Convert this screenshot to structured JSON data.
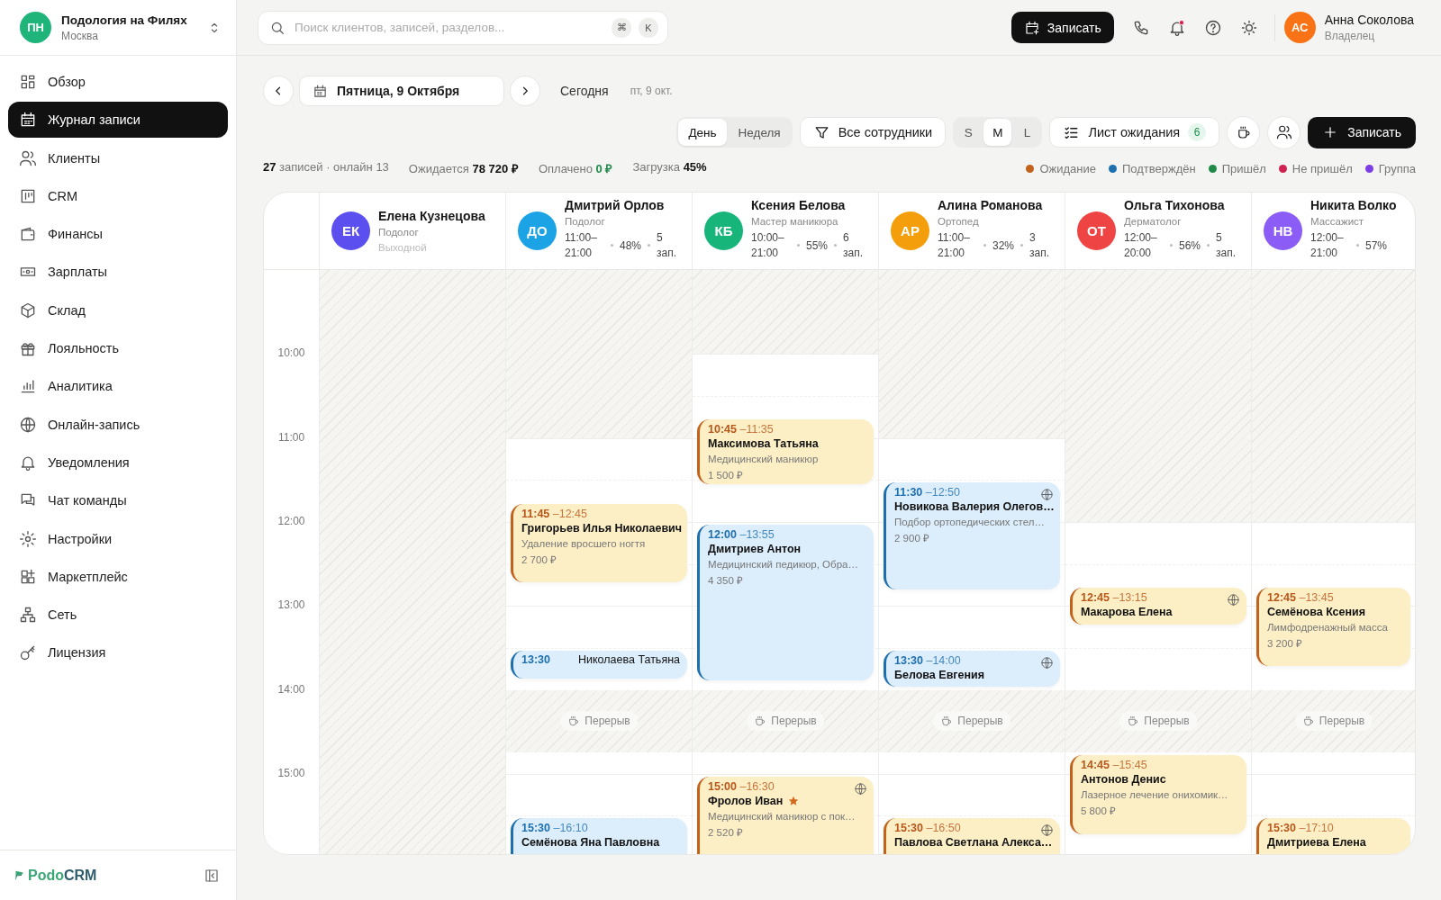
{
  "org": {
    "initials": "ПН",
    "name": "Подология на Филях",
    "city": "Москва"
  },
  "sidebar": {
    "items": [
      {
        "label": "Обзор",
        "selected": false
      },
      {
        "label": "Журнал записи",
        "selected": true
      },
      {
        "label": "Клиенты",
        "selected": false
      },
      {
        "label": "CRM",
        "selected": false
      },
      {
        "label": "Финансы",
        "selected": false
      },
      {
        "label": "Зарплаты",
        "selected": false
      },
      {
        "label": "Склад",
        "selected": false
      },
      {
        "label": "Лояльность",
        "selected": false
      },
      {
        "label": "Аналитика",
        "selected": false
      },
      {
        "label": "Онлайн-запись",
        "selected": false
      },
      {
        "label": "Уведомления",
        "selected": false
      },
      {
        "label": "Чат команды",
        "selected": false
      },
      {
        "label": "Настройки",
        "selected": false
      },
      {
        "label": "Маркетплейс",
        "selected": false
      },
      {
        "label": "Сеть",
        "selected": false
      },
      {
        "label": "Лицензия",
        "selected": false
      }
    ],
    "logo": {
      "part1": "Podo",
      "part2": "CRM"
    }
  },
  "topbar": {
    "search": {
      "placeholder": "Поиск клиентов, записей, разделов...",
      "keys": [
        "⌘",
        "K"
      ]
    },
    "book_button": "Записать",
    "notifications_unread": true,
    "user": {
      "initials": "АС",
      "name": "Анна Соколова",
      "role": "Владелец"
    }
  },
  "toolbar": {
    "date": "Пятница, 9 Октября",
    "today": "Сегодня",
    "today_hint": "пт, 9 окт.",
    "views": [
      {
        "label": "День",
        "selected": true
      },
      {
        "label": "Неделя",
        "selected": false
      }
    ],
    "staff_filter": "Все сотрудники",
    "sizes": [
      {
        "label": "S",
        "selected": false
      },
      {
        "label": "M",
        "selected": true
      },
      {
        "label": "L",
        "selected": false
      }
    ],
    "waiting_list": {
      "label": "Лист ожидания",
      "count": "6"
    },
    "book_button": "Записать"
  },
  "stats": [
    {
      "kind": "count",
      "value": "27",
      "label": "записей · онлайн 13"
    },
    {
      "kind": "amount",
      "label": "Ожидается",
      "value": "78 720 ₽"
    },
    {
      "kind": "paid",
      "label": "Оплачено",
      "value": "0 ₽"
    },
    {
      "kind": "amount",
      "label": "Загрузка",
      "value": "45%"
    }
  ],
  "legend": [
    {
      "label": "Ожидание",
      "color": "#c2621b"
    },
    {
      "label": "Подтверждён",
      "color": "#1d6fae"
    },
    {
      "label": "Пришёл",
      "color": "#1f8a4a"
    },
    {
      "label": "Не пришёл",
      "color": "#d0224f"
    },
    {
      "label": "Группа",
      "color": "#7b3fe4"
    }
  ],
  "time_labels": [
    "10:00",
    "11:00",
    "12:00",
    "13:00",
    "14:00",
    "15:00"
  ],
  "staff": [
    {
      "initials": "ЕК",
      "color": "#5b4ff0",
      "name": "Елена Кузнецова",
      "role": "Подолог",
      "kind": "off",
      "note": "Выходной"
    },
    {
      "initials": "ДО",
      "color": "#1ba3e6",
      "name": "Дмитрий Орлов",
      "role": "Подолог",
      "kind": "working",
      "hours": "11:00–21:00",
      "load": "48%",
      "count": "5 зап.",
      "break_label": "Перерыв",
      "events": [
        {
          "kind": "full",
          "confirmed": false,
          "start": "11:45",
          "end": "–12:45",
          "name": "Григорьев Илья Николаевич",
          "service": "Удаление вросшего ногтя",
          "price": "2 700 ₽",
          "online": false,
          "starred": false
        },
        {
          "kind": "compact",
          "confirmed": true,
          "start": "13:30",
          "name": "Николаева Татьяна",
          "online": false,
          "starred": false
        },
        {
          "kind": "full",
          "confirmed": true,
          "start": "15:30",
          "end": "–16:10",
          "name": "Семёнова Яна Павловна",
          "online": false,
          "starred": false
        }
      ]
    },
    {
      "initials": "КБ",
      "color": "#18b57a",
      "name": "Ксения Белова",
      "role": "Мастер маникюра",
      "kind": "working",
      "hours": "10:00–21:00",
      "load": "55%",
      "count": "6 зап.",
      "break_label": "Перерыв",
      "events": [
        {
          "kind": "full",
          "confirmed": false,
          "start": "10:45",
          "end": "–11:35",
          "name": "Максимова Татьяна",
          "service": "Медицинский маникюр",
          "price": "1 500 ₽",
          "online": false,
          "starred": false
        },
        {
          "kind": "full",
          "confirmed": true,
          "start": "12:00",
          "end": "–13:55",
          "name": "Дмитриев Антон",
          "service": "Медицинский педикюр, Обра…",
          "price": "4 350 ₽",
          "online": false,
          "starred": false
        },
        {
          "kind": "full",
          "confirmed": false,
          "start": "15:00",
          "end": "–16:30",
          "name": "Фролов Иван",
          "service": "Медицинский маникюр с пок…",
          "price": "2 520 ₽",
          "online": true,
          "starred": true
        }
      ]
    },
    {
      "initials": "АР",
      "color": "#f59e0b",
      "name": "Алина Романова",
      "role": "Ортопед",
      "kind": "working",
      "hours": "11:00–21:00",
      "load": "32%",
      "count": "3 зап.",
      "break_label": "Перерыв",
      "events": [
        {
          "kind": "full",
          "confirmed": true,
          "start": "11:30",
          "end": "–12:50",
          "name": "Новикова Валерия Олегов…",
          "service": "Подбор ортопедических стел…",
          "price": "2 900 ₽",
          "online": true,
          "starred": false
        },
        {
          "kind": "full",
          "confirmed": true,
          "start": "13:30",
          "end": "–14:00",
          "name": "Белова Евгения",
          "online": true,
          "starred": false
        },
        {
          "kind": "full",
          "confirmed": false,
          "start": "15:30",
          "end": "–16:50",
          "name": "Павлова Светлана Алекса…",
          "online": true,
          "starred": false
        }
      ]
    },
    {
      "initials": "ОТ",
      "color": "#ef4444",
      "name": "Ольга Тихонова",
      "role": "Дерматолог",
      "kind": "working",
      "hours": "12:00–20:00",
      "load": "56%",
      "count": "5 зап.",
      "break_label": "Перерыв",
      "events": [
        {
          "kind": "full",
          "confirmed": false,
          "start": "12:45",
          "end": "–13:15",
          "name": "Макарова Елена",
          "online": true,
          "starred": false
        },
        {
          "kind": "full",
          "confirmed": false,
          "start": "14:45",
          "end": "–15:45",
          "name": "Антонов Денис",
          "service": "Лазерное лечение онихомик…",
          "price": "5 800 ₽",
          "online": false,
          "starred": false
        }
      ]
    },
    {
      "initials": "НВ",
      "color": "#8b5cf6",
      "name": "Никита Волко",
      "role": "Массажист",
      "kind": "working",
      "hours": "12:00–21:00",
      "load": "57%",
      "break_label": "Перерыв",
      "events": [
        {
          "kind": "full",
          "confirmed": false,
          "start": "12:45",
          "end": "–13:45",
          "name": "Семёнова Ксения",
          "service": "Лимфодренажный масса",
          "price": "3 200 ₽",
          "online": false,
          "starred": false
        },
        {
          "kind": "full",
          "confirmed": false,
          "start": "15:30",
          "end": "–17:10",
          "name": "Дмитриева Елена",
          "online": false,
          "starred": false
        }
      ]
    }
  ]
}
